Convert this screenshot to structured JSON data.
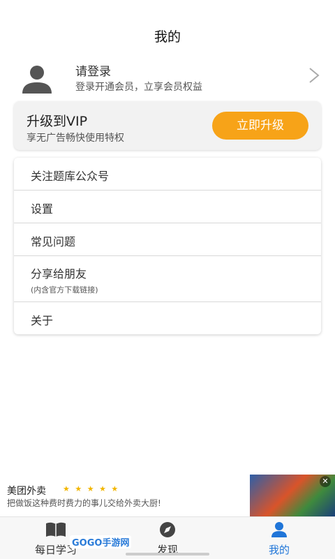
{
  "header": {
    "title": "我的"
  },
  "profile": {
    "login_title": "请登录",
    "login_sub": "登录开通会员，立享会员权益"
  },
  "vip": {
    "title": "升级到VIP",
    "subtitle": "享无广告畅快使用特权",
    "button": "立即升级",
    "button_color": "#f7a318"
  },
  "menu": {
    "items": [
      {
        "label": "关注题库公众号"
      },
      {
        "label": "设置"
      },
      {
        "label": "常见问题"
      },
      {
        "label": "分享给朋友",
        "sub": "(内含官方下载链接)"
      },
      {
        "label": "关于"
      }
    ]
  },
  "ad": {
    "title": "美团外卖",
    "stars": "★ ★ ★ ★ ★",
    "desc": "把做饭这种费时费力的事儿交给外卖大厨!",
    "close": "✕"
  },
  "tabbar": {
    "tabs": [
      {
        "label": "每日学习",
        "icon": "book-icon"
      },
      {
        "label": "发现",
        "icon": "compass-icon"
      },
      {
        "label": "我的",
        "icon": "person-icon",
        "active": true
      }
    ],
    "active_color": "#1f75d8"
  },
  "watermark": "GOGO手游网"
}
